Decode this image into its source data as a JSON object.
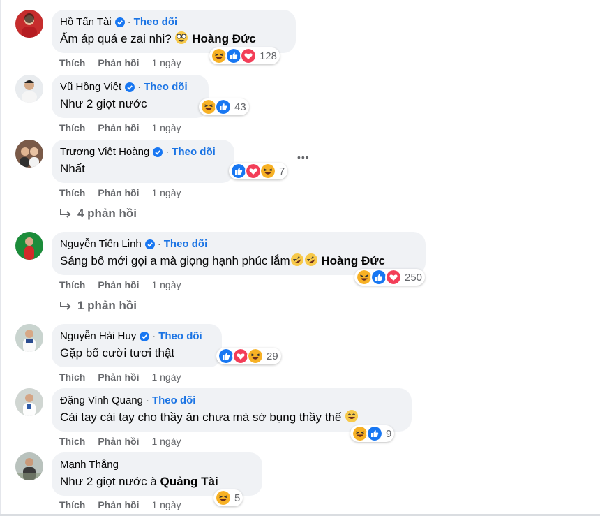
{
  "follow_label": "Theo dõi",
  "comments": [
    {
      "name": "Hồ Tấn Tài",
      "verified": true,
      "follow": true,
      "text": "Ấm áp quá e zai nhi?",
      "text_emoji": "nerd-face",
      "mention": "Hoàng Đức",
      "reactions": [
        "haha",
        "like",
        "love"
      ],
      "reaction_count": "128",
      "like": "Thích",
      "reply": "Phản hồi",
      "time": "1 ngày"
    },
    {
      "name": "Vũ Hồng Việt",
      "verified": true,
      "follow": true,
      "text": "Như 2 giọt nước",
      "reactions": [
        "haha",
        "like"
      ],
      "reaction_count": "43",
      "like": "Thích",
      "reply": "Phản hồi",
      "time": "1 ngày"
    },
    {
      "name": "Trương Việt Hoàng",
      "verified": true,
      "follow": true,
      "text": "Nhất",
      "reactions": [
        "like",
        "love",
        "haha"
      ],
      "reaction_count": "7",
      "like": "Thích",
      "reply": "Phản hồi",
      "time": "1 ngày",
      "replies_label": "4 phản hồi",
      "more_label": "•••"
    },
    {
      "name": "Nguyễn Tiến Linh",
      "verified": true,
      "follow": true,
      "text": "Sáng bố mới gọi a mà giọng hạnh phúc lắm",
      "text_emoji": "rofl x2",
      "mention": "Hoàng Đức",
      "reactions": [
        "haha",
        "like",
        "love"
      ],
      "reaction_count": "250",
      "like": "Thích",
      "reply": "Phản hồi",
      "time": "1 ngày",
      "replies_label": "1 phản hồi"
    },
    {
      "name": "Nguyễn Hải Huy",
      "verified": true,
      "follow": true,
      "text": "Gặp bố cười tươi thật",
      "reactions": [
        "like",
        "love",
        "haha"
      ],
      "reaction_count": "29",
      "like": "Thích",
      "reply": "Phản hồi",
      "time": "1 ngày"
    },
    {
      "name": "Đặng Vinh Quang",
      "verified": false,
      "follow": true,
      "text": "Cái tay cái tay cho thầy ăn chưa mà sờ bụng thầy thế",
      "text_emoji": "grinning-face",
      "reactions": [
        "haha",
        "like"
      ],
      "reaction_count": "9",
      "like": "Thích",
      "reply": "Phản hồi",
      "time": "1 ngày"
    },
    {
      "name": "Mạnh Thắng",
      "verified": false,
      "follow": false,
      "text": "Như 2 giọt nước à",
      "mention": "Quảng Tài",
      "reactions": [
        "haha"
      ],
      "reaction_count": "5",
      "like": "Thích",
      "reply": "Phản hồi",
      "time": "1 ngày"
    }
  ],
  "colors": {
    "follow": "#1b74e4",
    "bubble": "#f0f2f5",
    "meta": "#65676b",
    "like": "#1877f2",
    "love": "#f33e58",
    "haha": "#f7b125"
  }
}
